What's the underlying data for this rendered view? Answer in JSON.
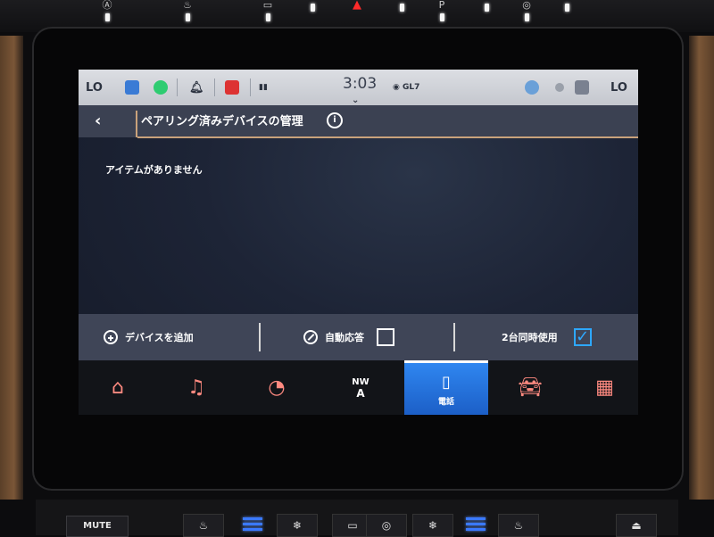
{
  "status_bar": {
    "left_temp": "LO",
    "right_temp": "LO",
    "time": "3:03",
    "gps_label": "GL7"
  },
  "header": {
    "back_icon": "chevron-left-icon",
    "title": "ペアリング済みデバイスの管理",
    "info_icon": "info-icon"
  },
  "content": {
    "empty_message": "アイテムがありません"
  },
  "options": {
    "add_device_label": "デバイスを追加",
    "auto_answer_label": "自動応答",
    "auto_answer_checked": false,
    "dual_use_label": "2台同時使用",
    "dual_use_checked": true
  },
  "nav": {
    "items": [
      {
        "icon": "home-icon",
        "label": ""
      },
      {
        "icon": "music-note-icon",
        "label": ""
      },
      {
        "icon": "drive-mode-icon",
        "label": ""
      },
      {
        "icon": "compass-icon",
        "label": "",
        "heading": "NW",
        "sub": "A"
      },
      {
        "icon": "phone-icon",
        "label": "電話",
        "active": true
      },
      {
        "icon": "car-icon",
        "label": ""
      },
      {
        "icon": "apps-grid-icon",
        "label": ""
      }
    ]
  },
  "hardware": {
    "mute_label": "MUTE"
  },
  "colors": {
    "accent": "#c9a27b",
    "active_nav": "#2f86f0",
    "nav_icon": "#ff8a80",
    "checked": "#2ea8ff"
  }
}
